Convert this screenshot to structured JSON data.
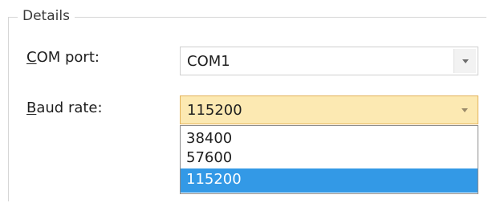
{
  "group": {
    "title": "Details"
  },
  "com_port": {
    "label_mnemonic": "C",
    "label_rest": "OM port:",
    "value": "COM1",
    "dropdown_icon": "chevron-down-icon"
  },
  "baud_rate": {
    "label_mnemonic": "B",
    "label_rest": "aud rate:",
    "value": "115200",
    "dropdown_icon": "chevron-down-icon",
    "options": [
      "38400",
      "57600",
      "115200"
    ],
    "selected_option": "115200"
  },
  "colors": {
    "focus_field_bg": "#fce9b2",
    "focus_field_border": "#e3b25a",
    "selection_bg": "#3399e6"
  }
}
